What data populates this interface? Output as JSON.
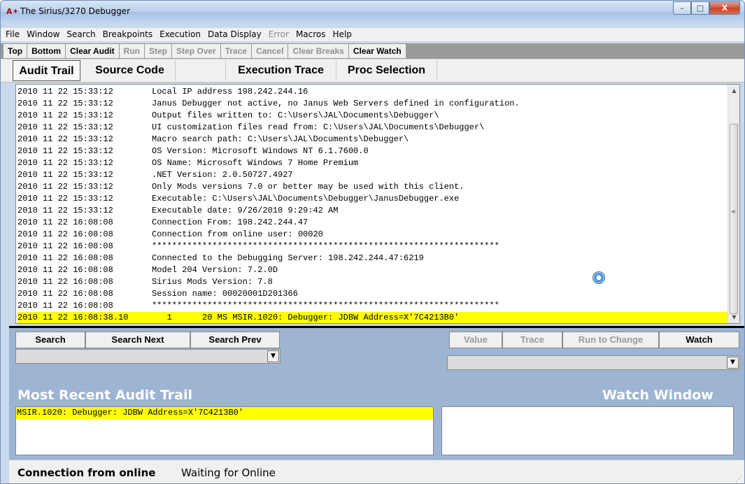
{
  "window": {
    "title": "The Sirius/3270 Debugger",
    "controls": {
      "minimize": "–",
      "maximize": "□",
      "close": "X"
    }
  },
  "menu": [
    {
      "label": "File",
      "enabled": true
    },
    {
      "label": "Window",
      "enabled": true
    },
    {
      "label": "Search",
      "enabled": true
    },
    {
      "label": "Breakpoints",
      "enabled": true
    },
    {
      "label": "Execution",
      "enabled": true
    },
    {
      "label": "Data Display",
      "enabled": true
    },
    {
      "label": "Error",
      "enabled": false
    },
    {
      "label": "Macros",
      "enabled": true
    },
    {
      "label": "Help",
      "enabled": true
    }
  ],
  "toolbar": [
    {
      "label": "Top",
      "enabled": true
    },
    {
      "label": "Bottom",
      "enabled": true
    },
    {
      "label": "Clear Audit",
      "enabled": true
    },
    {
      "label": "Run",
      "enabled": false
    },
    {
      "label": "Step",
      "enabled": false
    },
    {
      "label": "Step Over",
      "enabled": false
    },
    {
      "label": "Trace",
      "enabled": false
    },
    {
      "label": "Cancel",
      "enabled": false
    },
    {
      "label": "Clear Breaks",
      "enabled": false
    },
    {
      "label": "Clear Watch",
      "enabled": true
    }
  ],
  "tabs": [
    {
      "label": "Audit Trail",
      "active": true
    },
    {
      "label": "Source Code",
      "active": false
    },
    {
      "label": "",
      "active": false
    },
    {
      "label": "Execution Trace",
      "active": false
    },
    {
      "label": "Proc Selection",
      "active": false
    }
  ],
  "audit_trail": {
    "lines": [
      {
        "ts": "2010 11 22 15:33:12",
        "text": "Local IP address 198.242.244.16"
      },
      {
        "ts": "2010 11 22 15:33:12",
        "text": "Janus Debugger not active, no Janus Web Servers defined in configuration."
      },
      {
        "ts": "2010 11 22 15:33:12",
        "text": "Output files written to: C:\\Users\\JAL\\Documents\\Debugger\\"
      },
      {
        "ts": "2010 11 22 15:33:12",
        "text": "UI customization files read from: C:\\Users\\JAL\\Documents\\Debugger\\"
      },
      {
        "ts": "2010 11 22 15:33:12",
        "text": "Macro search path: C:\\Users\\JAL\\Documents\\Debugger\\"
      },
      {
        "ts": "2010 11 22 15:33:12",
        "text": "OS Version: Microsoft Windows NT 6.1.7600.0"
      },
      {
        "ts": "2010 11 22 15:33:12",
        "text": "OS Name: Microsoft Windows 7 Home Premium"
      },
      {
        "ts": "2010 11 22 15:33:12",
        "text": ".NET Version: 2.0.50727.4927"
      },
      {
        "ts": "2010 11 22 15:33:12",
        "text": "Only Mods versions 7.0 or better may be used with this client."
      },
      {
        "ts": "2010 11 22 15:33:12",
        "text": "Executable: C:\\Users\\JAL\\Documents\\Debugger\\JanusDebugger.exe"
      },
      {
        "ts": "2010 11 22 15:33:12",
        "text": "Executable date: 9/26/2010 9:29:42 AM"
      },
      {
        "ts": "2010 11 22 16:08:08",
        "text": "Connection From: 198.242.244.47"
      },
      {
        "ts": "2010 11 22 16:08:08",
        "text": "Connection from online user: 00020"
      },
      {
        "ts": "2010 11 22 16:08:08",
        "text": "*********************************************************************"
      },
      {
        "ts": "2010 11 22 16:08:08",
        "text": "Connected to the Debugging Server: 198.242.244.47:6219"
      },
      {
        "ts": "2010 11 22 16:08:08",
        "text": "Model 204 Version: 7.2.0D"
      },
      {
        "ts": "2010 11 22 16:08:08",
        "text": "Sirius Mods Version: 7.8"
      },
      {
        "ts": "2010 11 22 16:08:08",
        "text": "Session name: 00020001D201366"
      },
      {
        "ts": "2010 11 22 16:08:08",
        "text": "*********************************************************************"
      },
      {
        "ts": "2010 11 22 16:08:38.10",
        "text": "   1      20 MS MSIR.1020: Debugger: JDBW Address=X'7C4213B0'"
      }
    ],
    "highlighted_index": 19
  },
  "search": {
    "search_label": "Search",
    "search_next_label": "Search Next",
    "search_prev_label": "Search Prev",
    "combo_value": ""
  },
  "watch_controls": {
    "value_label": "Value",
    "trace_label": "Trace",
    "run_to_change_label": "Run to Change",
    "watch_label": "Watch",
    "combo_value": ""
  },
  "recent": {
    "title": "Most Recent Audit Trail",
    "text": "MSIR.1020: Debugger: JDBW Address=X'7C4213B0'"
  },
  "watch_window": {
    "title": "Watch Window"
  },
  "status": {
    "label": "Connection from online",
    "value": "Waiting for Online"
  },
  "colors": {
    "highlight": "#ffff00",
    "panel_bg": "#9db4d3",
    "toolbar_bg": "#9a9a9a"
  }
}
